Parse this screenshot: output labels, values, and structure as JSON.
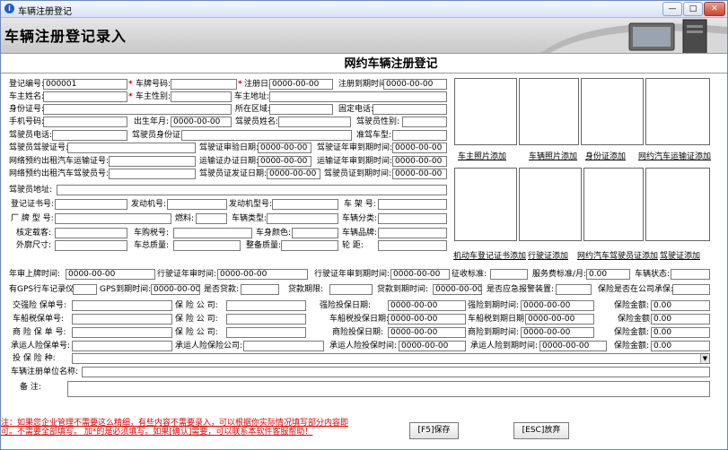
{
  "window": {
    "title": "车辆注册登记"
  },
  "header": {
    "title": "车辆注册登记录入"
  },
  "form": {
    "title": "网约车辆注册登记",
    "r1": {
      "reg_no_label": "登记编号:",
      "reg_no": "000001",
      "plate_label": "车牌号码:",
      "reg_date_label": "注册日期:",
      "reg_date": "0000-00-00",
      "reg_expire_label": "注册到期时间:",
      "reg_expire": "0000-00-00"
    },
    "r2": {
      "owner_label": "车主姓名:",
      "gender_label": "车主性别:",
      "address_label": "车主地址:"
    },
    "r3": {
      "idno_label": "身份证号:",
      "area_label": "所在区域:",
      "phone_label": "固定电话:"
    },
    "r4": {
      "mobile_label": "手机号码:",
      "birth_label": "出生年月:",
      "birth": "0000-00-00",
      "driver_name_label": "驾驶员姓名:",
      "driver_gender_label": "驾驶员性别:"
    },
    "r5": {
      "driver_phone_label": "驾驶员电话:",
      "driver_id_label": "驾驶员身份证:",
      "allowed_label": "准驾车型:"
    },
    "r6": {
      "license_no_label": "驾驶员驾驶证号:",
      "lic_review_label": "驾驶证审验日期:",
      "lic_review": "0000-00-00",
      "lic_review_expire_label": "驾驶证年审到期时间:",
      "lic_review_expire": "0000-00-00"
    },
    "r7": {
      "transport_label": "网络预约出租汽车运输证号:",
      "transport_date_label": "运输证办证日期:",
      "transport_date": "0000-00-00",
      "transport_expire_label": "运输证年审到期时间:",
      "transport_expire": "0000-00-00"
    },
    "r8": {
      "driver_cert_label": "网络预约出租汽车驾驶员号:",
      "cert_issue_label": "驾驶员证发证日期:",
      "cert_issue": "0000-00-00",
      "cert_expire_label": "驾驶员证到期时间:",
      "cert_expire": "0000-00-00"
    },
    "r9": {
      "driver_addr_label": "驾驶员地址:"
    },
    "r10": {
      "cert_book_label": "登记证书号:",
      "engine_label": "发动机号:",
      "engine_model_label": "发动机型号:",
      "frame_label": "车 架 号:"
    },
    "r11": {
      "factory_label": "厂 牌 型 号:",
      "fuel_label": "燃料:",
      "vtype_label": "车辆类型:",
      "vclass_label": "车辆分类:"
    },
    "r12": {
      "seats_label": "核定载客:",
      "tax_label": "车购税号:",
      "color_label": "车身颜色:",
      "brand_label": "车辆品牌:"
    },
    "r13": {
      "size_label": "外廓尺寸:",
      "mass_label": "车总质量:",
      "curb_label": "整备质量:",
      "wheel_label": "轮    距:"
    },
    "r14": {
      "first_label": "年审上牌时间:",
      "first": "0000-00-00",
      "yreview_label": "行驶证年审时间:",
      "yreview": "0000-00-00",
      "yexpire_label": "行驶证年审到期时间:",
      "yexpire": "0000-00-00",
      "fee_std_label": "征收标准:",
      "svc_label": "服务费标准/月:",
      "svc": "0.00",
      "status_label": "车辆状态:"
    },
    "r15": {
      "gps_label": "有GPS行车记录仪:",
      "gps_expire_label": "GPS到期时间:",
      "gps_expire": "0000-00-00",
      "loan_label": "是否贷款:",
      "loan_term_label": "贷款期限:",
      "loan_expire_label": "贷款到期时间:",
      "loan_expire": "0000-00-00",
      "alarm_label": "是否应急报警装置:",
      "ins_comp_label": "保险是否在公司承保:"
    },
    "r16": {
      "ci_label": "交强险 保单号:",
      "ins_co_label": "保 险 公 司:",
      "ins_time_label": "强险投保日期:",
      "ins_time": "0000-00-00",
      "ins_expire_label": "强险到期时间:",
      "ins_expire": "0000-00-00",
      "amt_label": "保险金额:",
      "amt": "0.00"
    },
    "r17": {
      "tax_no_label": "车船税保单号:",
      "ins_co_label": "保 险 公 司:",
      "ins_time_label": "车船税投保日期:",
      "ins_time": "0000-00-00",
      "ins_expire_label": "车船税到期日期:",
      "ins_expire": "0000-00-00",
      "amt_label": "保险金额:",
      "amt": "0.00"
    },
    "r18": {
      "com_label": "商 险 保 单 号:",
      "ins_co_label": "保 险 公 司:",
      "ins_time_label": "商险投保日期:",
      "ins_time": "0000-00-00",
      "ins_expire_label": "商险到期时间:",
      "ins_expire": "0000-00-00",
      "amt_label": "保险金额:",
      "amt": "0.00"
    },
    "r19": {
      "carrier_label": "承运人险保单号:",
      "carrier_co_label": "承运人险保险公司:",
      "ins_time_label": "承运人险投保时间:",
      "ins_time": "0000-00-00",
      "ins_expire_label": "承运人险到期时间:",
      "ins_expire": "0000-00-00",
      "amt_label": "保险金额:",
      "amt": "0.00"
    },
    "r20": {
      "kind_label": "投 保 险 种:"
    },
    "r21": {
      "unit_label": "车辆注册单位名称:"
    },
    "r22": {
      "remark_label": "备      注:"
    }
  },
  "photos": {
    "top": [
      "车主照片添加",
      "车辆照片添加",
      "身份证添加",
      "网约汽车运输证添加"
    ],
    "bottom": [
      "机动车登记证书添加",
      "行驶证添加",
      "网约汽车驾驶员证添加",
      "驾驶证添加"
    ]
  },
  "footer": {
    "note1": "注：如果您企业管理不需要这么精细，有些内容不需要录入，可以根据你实际情况填写部分内容即",
    "note2": "可。不需要全部填写。 加*的是必须填写。如果[确认]需要，可以联系本软件客服帮助！",
    "save": "[F5]保存",
    "cancel": "[ESC]放弃"
  }
}
